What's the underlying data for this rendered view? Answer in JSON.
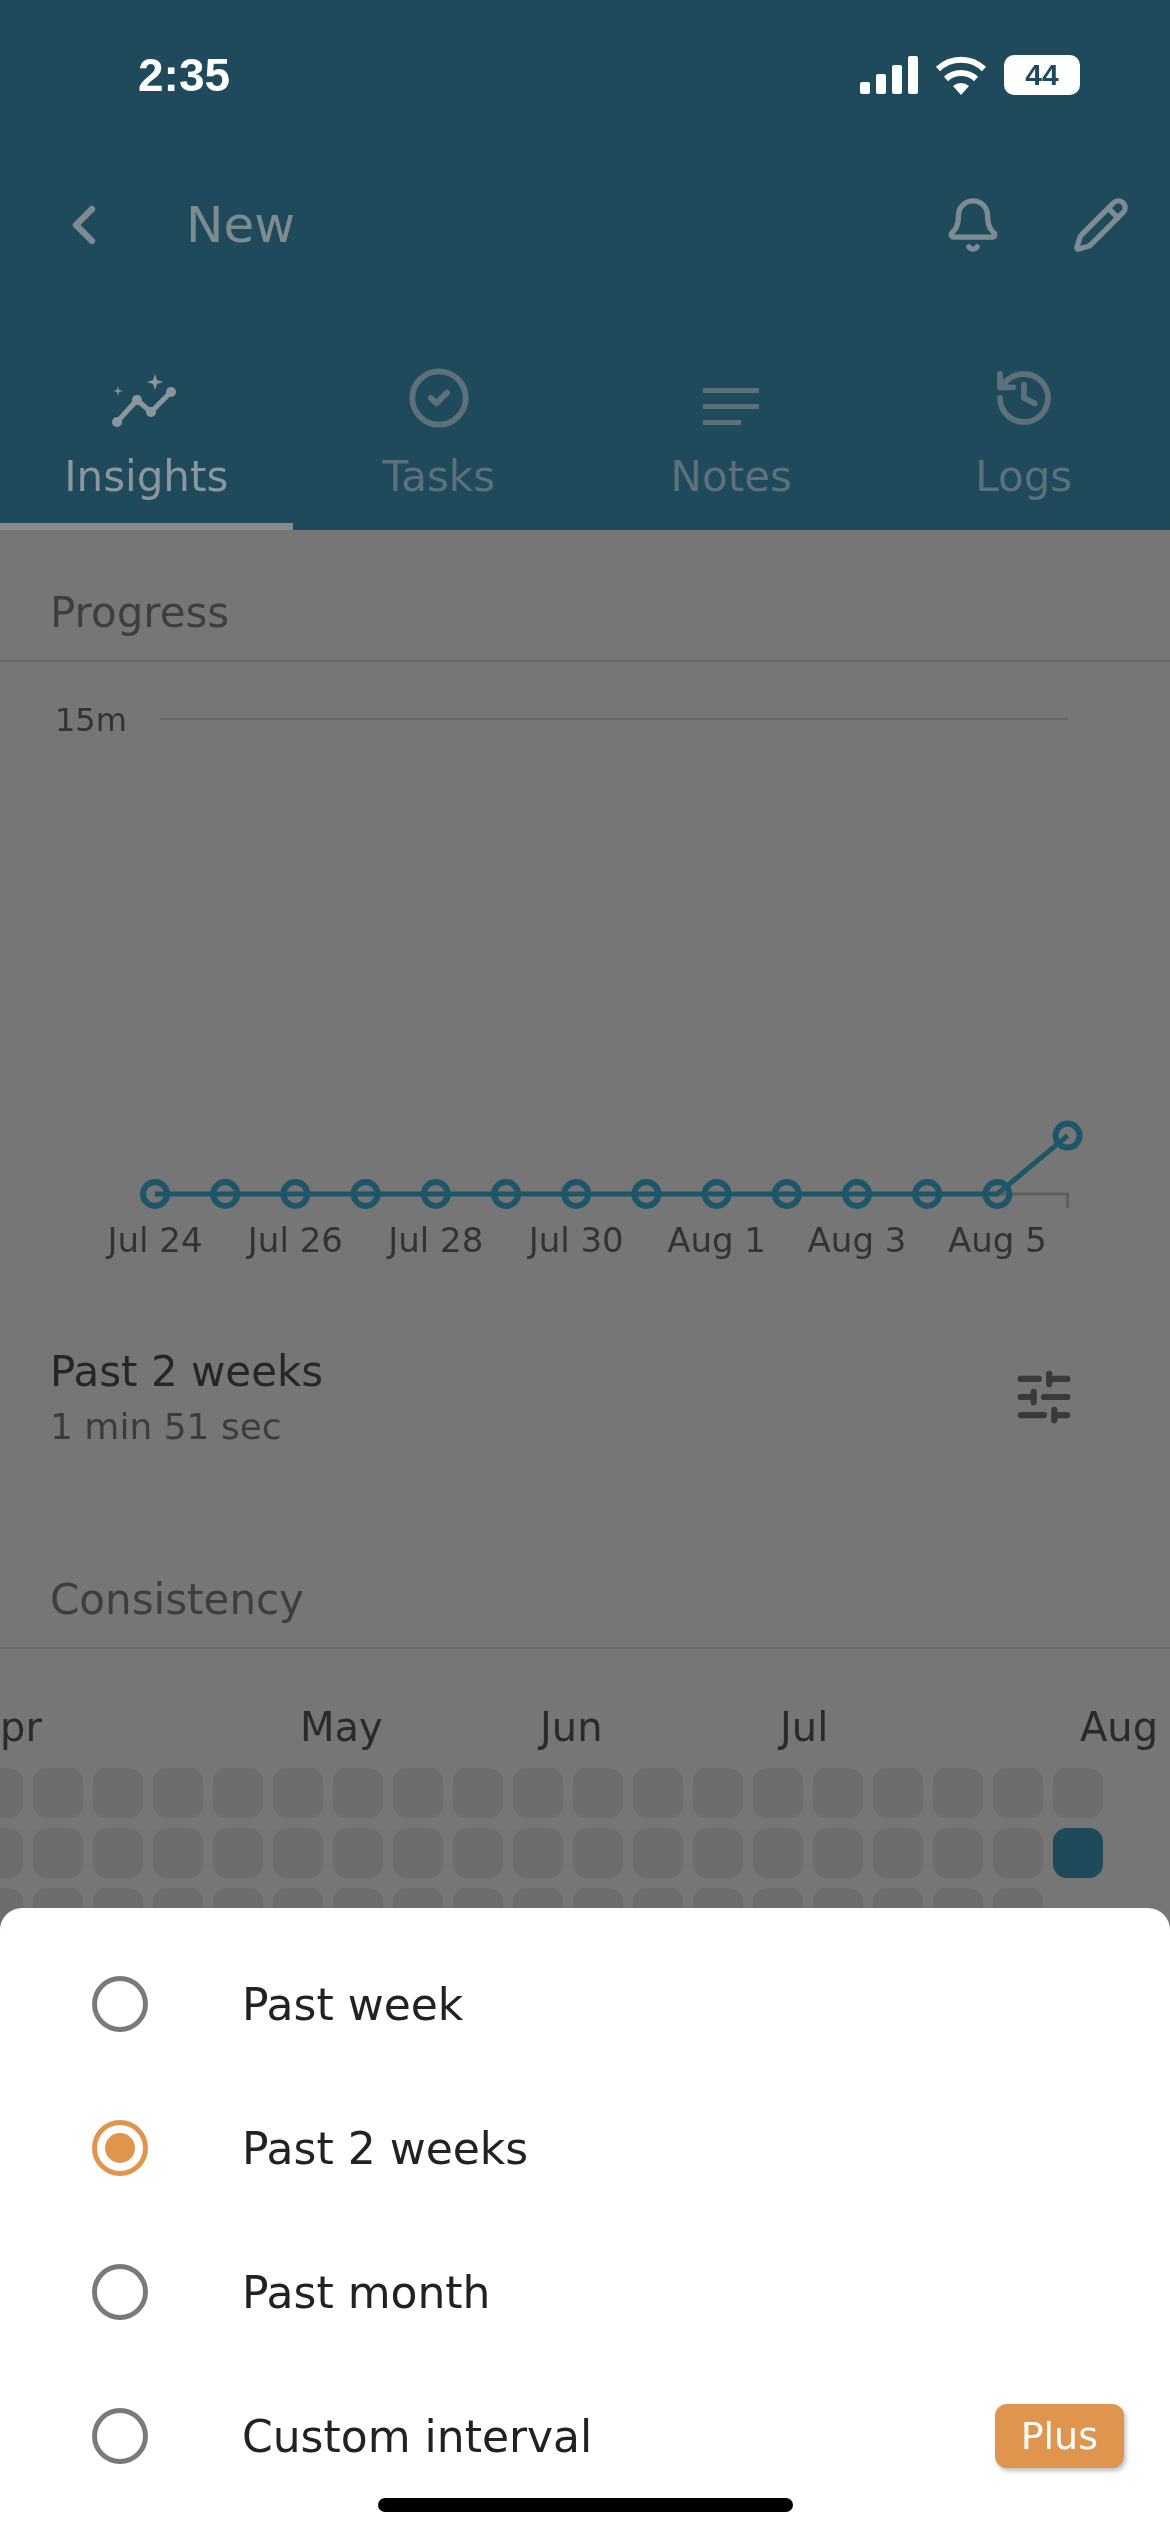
{
  "status_bar": {
    "time": "2:35",
    "battery": "44"
  },
  "header": {
    "title": "New"
  },
  "tabs": [
    {
      "label": "Insights",
      "selected": true
    },
    {
      "label": "Tasks",
      "selected": false
    },
    {
      "label": "Notes",
      "selected": false
    },
    {
      "label": "Logs",
      "selected": false
    }
  ],
  "progress": {
    "title": "Progress",
    "chart": {
      "y_label": "15m",
      "x_labels": [
        "Jul 24",
        "Jul 26",
        "Jul 28",
        "Jul 30",
        "Aug 1",
        "Aug 3",
        "Aug 5"
      ]
    },
    "period": "Past 2 weeks",
    "total": "1 min 51 sec"
  },
  "consistency": {
    "title": "Consistency",
    "months": [
      {
        "label": "pr"
      },
      {
        "label": "May"
      },
      {
        "label": "Jun"
      },
      {
        "label": "Jul"
      },
      {
        "label": "Aug"
      }
    ],
    "weeks": [
      [
        false,
        false,
        false
      ],
      [
        false,
        false,
        false
      ],
      [
        false,
        false,
        false
      ],
      [
        false,
        false,
        false
      ],
      [
        false,
        false,
        false
      ],
      [
        false,
        false,
        false
      ],
      [
        false,
        false,
        false
      ],
      [
        false,
        false,
        false
      ],
      [
        false,
        false,
        false
      ],
      [
        false,
        false,
        false
      ],
      [
        false,
        false,
        false
      ],
      [
        false,
        false,
        false
      ],
      [
        false,
        false,
        false
      ],
      [
        false,
        false,
        false
      ],
      [
        false,
        false,
        false
      ],
      [
        false,
        false,
        false
      ],
      [
        false,
        false,
        false
      ],
      [
        false,
        false,
        false
      ],
      [
        false,
        true
      ]
    ]
  },
  "period_sheet": {
    "options": [
      {
        "label": "Past week",
        "selected": false
      },
      {
        "label": "Past 2 weeks",
        "selected": true
      },
      {
        "label": "Past month",
        "selected": false
      },
      {
        "label": "Custom interval",
        "selected": false,
        "badge": "Plus"
      }
    ]
  }
}
